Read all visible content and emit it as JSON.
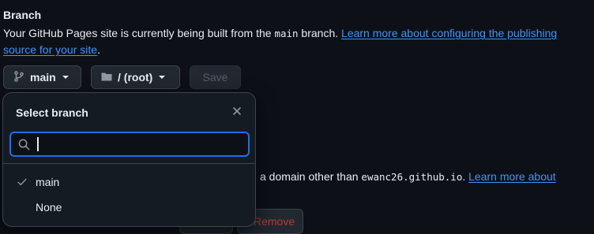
{
  "section": {
    "heading": "Branch",
    "desc_prefix": "Your GitHub Pages site is currently being built from the ",
    "desc_branch_code": "main",
    "desc_mid": " branch. ",
    "desc_link": "Learn more about configuring the publishing source for your site",
    "desc_suffix": "."
  },
  "controls": {
    "branch_button": "main",
    "folder_button": "/ (root)",
    "save_button": "Save"
  },
  "behind": {
    "text_prefix": "a domain other than ",
    "domain_code": "ewanc26.github.io",
    "text_after": ". ",
    "link": "Learn more about",
    "remove_button": "Remove"
  },
  "popover": {
    "title": "Select branch",
    "search": {
      "value": "",
      "placeholder": ""
    },
    "options": [
      {
        "label": "main",
        "selected": true
      },
      {
        "label": "None",
        "selected": false
      }
    ]
  },
  "colors": {
    "background": "#0d1117",
    "link": "#4493f8",
    "focus_border": "#1f6feb"
  },
  "icons": [
    "git-branch-icon",
    "caret-down-icon",
    "folder-icon",
    "close-icon",
    "search-icon",
    "check-icon"
  ]
}
